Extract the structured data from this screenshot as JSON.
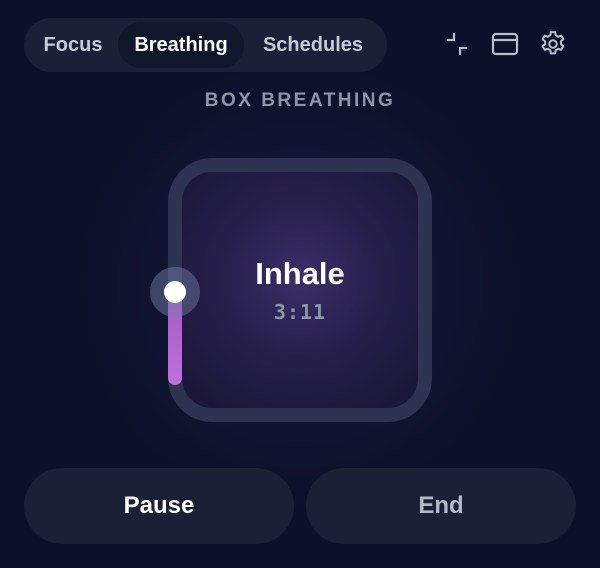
{
  "tabs": [
    {
      "label": "Focus",
      "active": false
    },
    {
      "label": "Breathing",
      "active": true
    },
    {
      "label": "Schedules",
      "active": false
    }
  ],
  "toolbar": {
    "icons": [
      "minimize-icon",
      "window-icon",
      "gear-icon"
    ]
  },
  "mode_title": "BOX BREATHING",
  "breathing": {
    "phase": "Inhale",
    "timer": "3:11"
  },
  "controls": {
    "pause_label": "Pause",
    "end_label": "End"
  },
  "colors": {
    "background": "#0b1129",
    "tab_bar": "#1a2136",
    "active_tab": "#10172b",
    "box_border": "#2d3350",
    "progress": "#b565d2"
  }
}
